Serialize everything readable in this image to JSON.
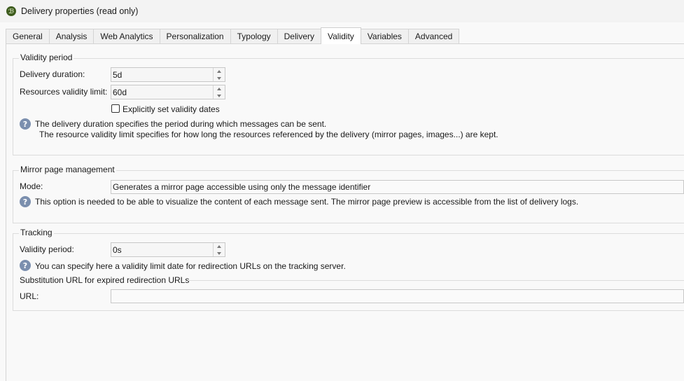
{
  "window": {
    "title": "Delivery properties (read only)",
    "app_icon_glyph": "ℬ"
  },
  "tabs": [
    {
      "label": "General"
    },
    {
      "label": "Analysis"
    },
    {
      "label": "Web Analytics"
    },
    {
      "label": "Personalization"
    },
    {
      "label": "Typology"
    },
    {
      "label": "Delivery"
    },
    {
      "label": "Validity",
      "active": true
    },
    {
      "label": "Variables"
    },
    {
      "label": "Advanced"
    }
  ],
  "validity_period": {
    "title": "Validity period",
    "delivery_duration_label": "Delivery duration:",
    "delivery_duration_value": "5d",
    "resources_validity_label": "Resources validity limit:",
    "resources_validity_value": "60d",
    "explicit_dates_label": "Explicitly set validity dates",
    "explicit_dates_checked": false,
    "help_line1": "The delivery duration specifies the period during which messages can be sent.",
    "help_line2": "The resource validity limit specifies for how long the resources referenced by the delivery (mirror pages, images...) are kept."
  },
  "mirror_page": {
    "title": "Mirror page management",
    "mode_label": "Mode:",
    "mode_value": "Generates a mirror page accessible using only the message identifier",
    "help_text": "This option is needed to be able to visualize the content of each message sent. The mirror page preview is accessible from the list of delivery logs."
  },
  "tracking": {
    "title": "Tracking",
    "validity_label": "Validity period:",
    "validity_value": "0s",
    "help_text": "You can specify here a validity limit date for redirection URLs on the tracking server.",
    "substitution_title": "Substitution URL for expired redirection URLs",
    "url_label": "URL:",
    "url_value": ""
  },
  "colors": {
    "help_icon": "#7b8fae",
    "active_tab": "#ffffff"
  }
}
